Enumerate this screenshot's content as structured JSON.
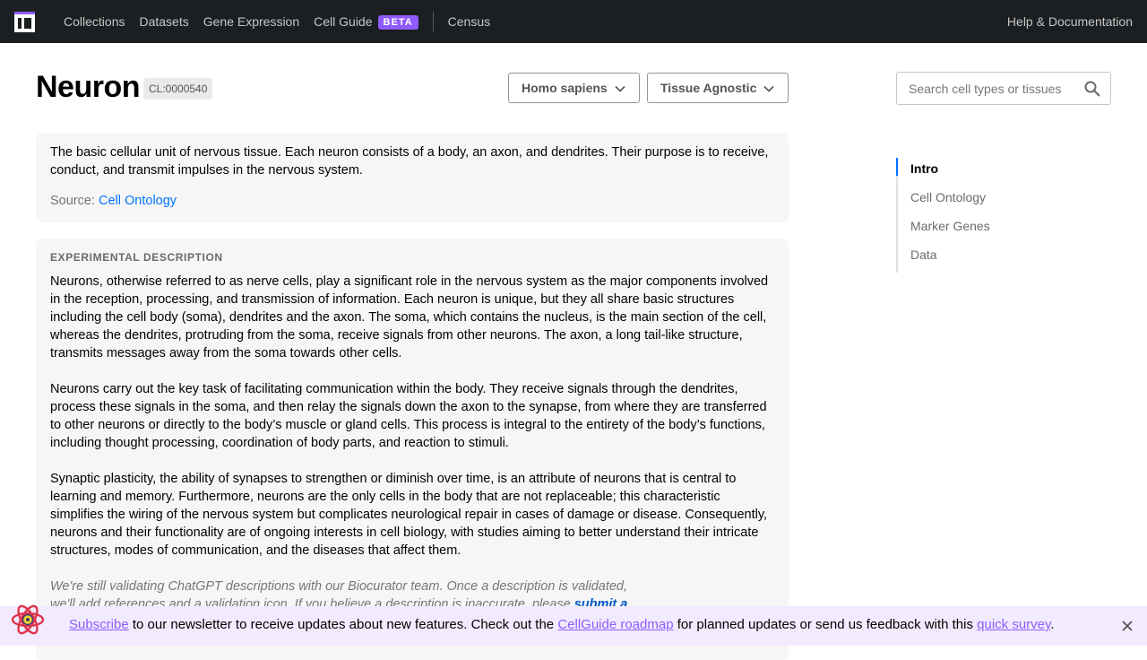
{
  "nav": {
    "links": [
      "Collections",
      "Datasets",
      "Gene Expression",
      "Cell Guide",
      "Census"
    ],
    "beta": "BETA",
    "help": "Help & Documentation"
  },
  "header": {
    "title": "Neuron",
    "cl_id": "CL:0000540",
    "species": "Homo sapiens",
    "tissue": "Tissue Agnostic",
    "search_placeholder": "Search cell types or tissues"
  },
  "intro": {
    "description": "The basic cellular unit of nervous tissue. Each neuron consists of a body, an axon, and dendrites. Their purpose is to receive, conduct, and transmit impulses in the nervous system.",
    "source_label": "Source:",
    "source_link": "Cell Ontology"
  },
  "experimental": {
    "label": "EXPERIMENTAL DESCRIPTION",
    "paragraphs": [
      "Neurons, otherwise referred to as nerve cells, play a significant role in the nervous system as the major components involved in the reception, processing, and transmission of information. Each neuron is unique, but they all share basic structures including the cell body (soma), dendrites and the axon. The soma, which contains the nucleus, is the main section of the cell, whereas the dendrites, protruding from the soma, receive signals from other neurons. The axon, a long tail-like structure, transmits messages away from the soma towards other cells.",
      "Neurons carry out the key task of facilitating communication within the body. They receive signals through the dendrites, process these signals in the soma, and then relay the signals down the axon to the synapse, from where they are transferred to other neurons or directly to the body’s muscle or gland cells. This process is integral to the entirety of the body’s functions, including thought processing, coordination of body parts, and reaction to stimuli.",
      "Synaptic plasticity, the ability of synapses to strengthen or diminish over time, is an attribute of neurons that is central to learning and memory. Furthermore, neurons are the only cells in the body that are not replaceable; this characteristic simplifies the wiring of the nervous system but complicates neurological repair in cases of damage or disease. Consequently, neurons and their functionality are of ongoing interests in cell biology, with studies aiming to better understand their intricate structures, modes of communication, and the diseases that affect them."
    ],
    "disclaimer": "We're still validating ChatGPT descriptions with our Biocurator team. Once a description is validated, we'll add references and a validation icon. If you believe a description is inaccurate, please",
    "disclaimer_link": "submit a"
  },
  "toc": [
    "Intro",
    "Cell Ontology",
    "Marker Genes",
    "Data"
  ],
  "banner": {
    "subscribe": "Subscribe",
    "text1": " to our newsletter to receive updates about new features. Check out the ",
    "roadmap": "CellGuide roadmap",
    "text2": " for planned updates or send us feedback with this ",
    "survey": "quick survey",
    "text3": "."
  },
  "colors": {
    "nav_bg": "#1c1f21",
    "accent": "#8f5aff",
    "link": "#0073ff"
  }
}
